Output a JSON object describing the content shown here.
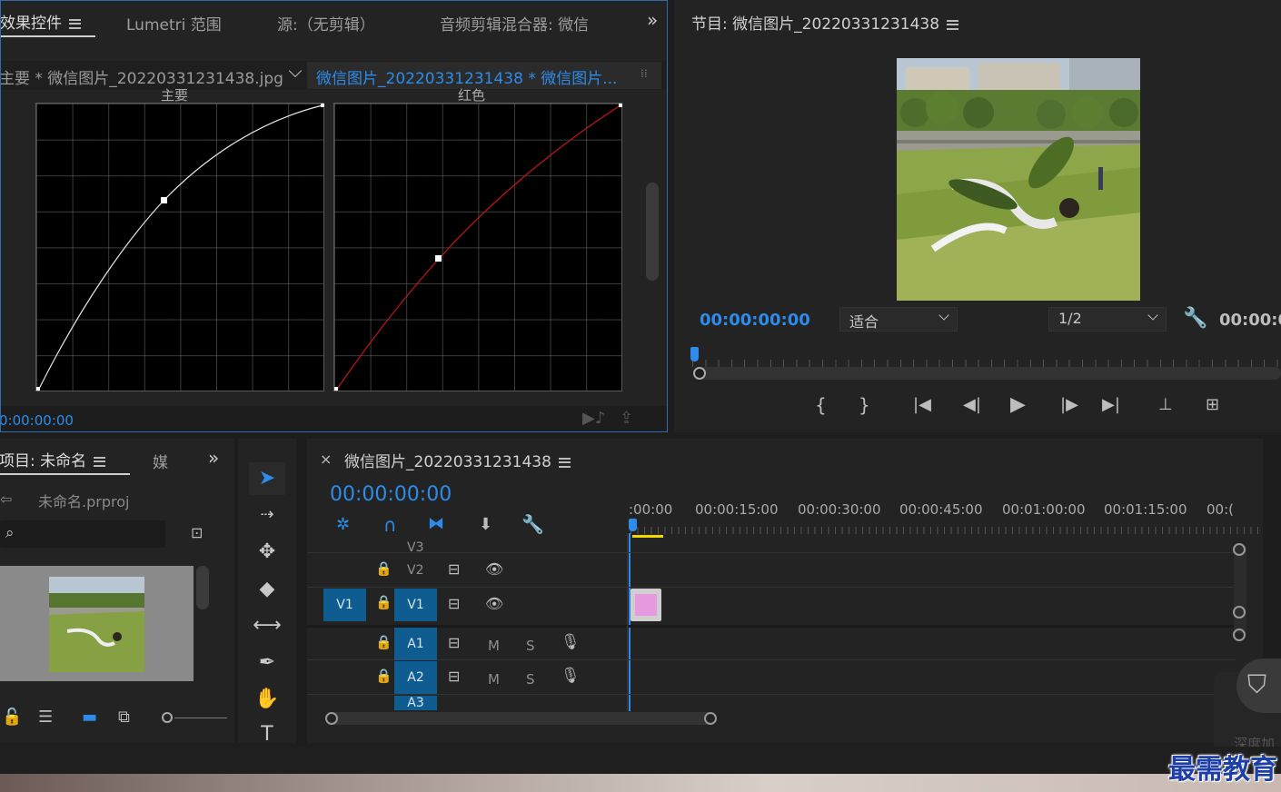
{
  "effect_panel": {
    "tabs": [
      {
        "label": "效果控件"
      },
      {
        "label": "Lumetri 范围"
      },
      {
        "label": "源:（无剪辑）"
      },
      {
        "label": "音频剪辑混合器: 微信"
      }
    ],
    "overflow": "»",
    "source_clip": "主要 * 微信图片_20220331231438.jpg",
    "sequence_clip": "微信图片_20220331231438 * 微信图片...",
    "curve1_title": "主要",
    "curve2_title": "红色",
    "timecode": "0:00:00:00"
  },
  "program_monitor": {
    "title": "节目: 微信图片_20220331231438",
    "timecode": "00:00:00:00",
    "fit_label": "适合",
    "resolution_label": "1/2",
    "duration_partial": "00:00:0"
  },
  "project_panel": {
    "title": "项目: 未命名",
    "next_tab": "媒",
    "overflow": "»",
    "project_file": "未命名.prproj"
  },
  "timeline": {
    "close": "×",
    "title": "微信图片_20220331231438",
    "timecode": "00:00:00:00",
    "ruler": [
      ":00:00",
      "00:00:15:00",
      "00:00:30:00",
      "00:00:45:00",
      "00:01:00:00",
      "00:01:15:00",
      "00:("
    ],
    "tracks": {
      "v3": "V3",
      "v2": "V2",
      "v1_source": "V1",
      "v1": "V1",
      "a1": "A1",
      "a2": "A2",
      "a3": "A3",
      "mute": "M",
      "solo": "S"
    }
  },
  "watermark": {
    "brand": "最需教育",
    "overlay": "深度加"
  },
  "colors": {
    "accent": "#2d8ceb",
    "track_blue": "#0f5c91",
    "clip_pink": "#e89ae0",
    "work_area": "#f0d800"
  }
}
